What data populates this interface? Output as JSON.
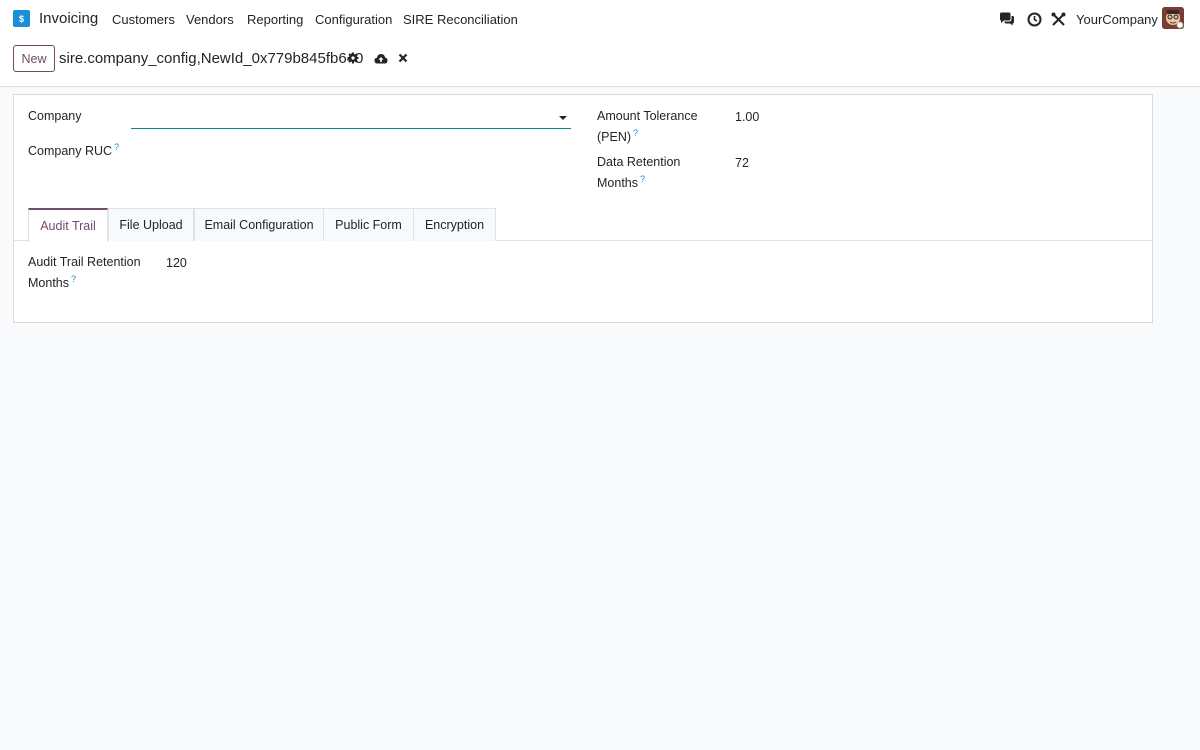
{
  "navbar": {
    "app_name": "Invoicing",
    "menu": [
      "Customers",
      "Vendors",
      "Reporting",
      "Configuration",
      "SIRE Reconciliation"
    ],
    "company": "YourCompany",
    "icons": [
      "chat-icon",
      "clock-icon",
      "tools-icon"
    ]
  },
  "control_panel": {
    "new_label": "New",
    "record_title": "sire.company_config,NewId_0x779b845fb640",
    "icons": [
      "gear-icon",
      "cloud-upload-icon",
      "close-icon"
    ]
  },
  "form": {
    "company_label": "Company",
    "company_value": "",
    "company_ruc_label": "Company RUC",
    "help_mark": "?",
    "amount_tolerance_label_1": "Amount Tolerance",
    "amount_tolerance_label_2": "(PEN)",
    "amount_tolerance_value": "1.00",
    "data_retention_label_1": "Data Retention",
    "data_retention_label_2": "Months",
    "data_retention_value": "72"
  },
  "tabs": [
    {
      "label": "Audit Trail",
      "active": true
    },
    {
      "label": "File Upload",
      "active": false
    },
    {
      "label": "Email Configuration",
      "active": false
    },
    {
      "label": "Public Form",
      "active": false
    },
    {
      "label": "Encryption",
      "active": false
    }
  ],
  "audit_trail": {
    "label_1": "Audit Trail Retention",
    "label_2": "Months",
    "value": "120"
  },
  "colors": {
    "brand": "#714b67",
    "help": "#1e8dc8",
    "focus": "#0b8a8a"
  }
}
